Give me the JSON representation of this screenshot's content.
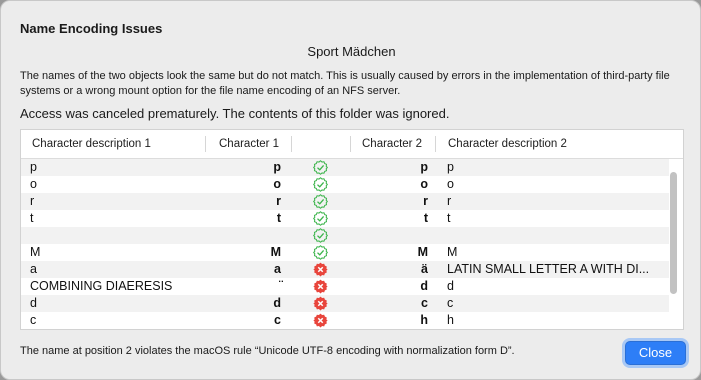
{
  "dialog": {
    "title": "Name Encoding Issues",
    "object_name": "Sport Mädchen",
    "description": "The names of the two objects look the same but do not match. This is usually caused by errors in the implementation of third-party file systems or a wrong mount option for the file name encoding of an NFS server.",
    "access_message": "Access was canceled prematurely.  The contents of this folder was ignored.",
    "footer": "The name at position 2 violates the macOS rule “Unicode UTF-8 encoding with normalization form D”.",
    "close_label": "Close"
  },
  "table": {
    "headers": {
      "desc1": "Character description 1",
      "char1": "Character 1",
      "char2": "Character 2",
      "desc2": "Character description 2"
    },
    "rows": [
      {
        "desc1": "p",
        "char1": "p",
        "status": "ok",
        "char2": "p",
        "desc2": "p"
      },
      {
        "desc1": "o",
        "char1": "o",
        "status": "ok",
        "char2": "o",
        "desc2": "o"
      },
      {
        "desc1": "r",
        "char1": "r",
        "status": "ok",
        "char2": "r",
        "desc2": "r"
      },
      {
        "desc1": "t",
        "char1": "t",
        "status": "ok",
        "char2": "t",
        "desc2": "t"
      },
      {
        "desc1": "",
        "char1": "",
        "status": "ok",
        "char2": "",
        "desc2": ""
      },
      {
        "desc1": "M",
        "char1": "M",
        "status": "ok",
        "char2": "M",
        "desc2": "M"
      },
      {
        "desc1": "a",
        "char1": "a",
        "status": "error",
        "char2": "ä",
        "desc2": "LATIN SMALL LETTER A WITH DI..."
      },
      {
        "desc1": "COMBINING DIAERESIS",
        "char1": "̈",
        "status": "error",
        "char2": "d",
        "desc2": "d"
      },
      {
        "desc1": "d",
        "char1": "d",
        "status": "error",
        "char2": "c",
        "desc2": "c"
      },
      {
        "desc1": "c",
        "char1": "c",
        "status": "error",
        "char2": "h",
        "desc2": "h"
      }
    ]
  },
  "colors": {
    "ok": "#3cb44b",
    "error": "#e8453c",
    "accent": "#2d7ef7"
  }
}
